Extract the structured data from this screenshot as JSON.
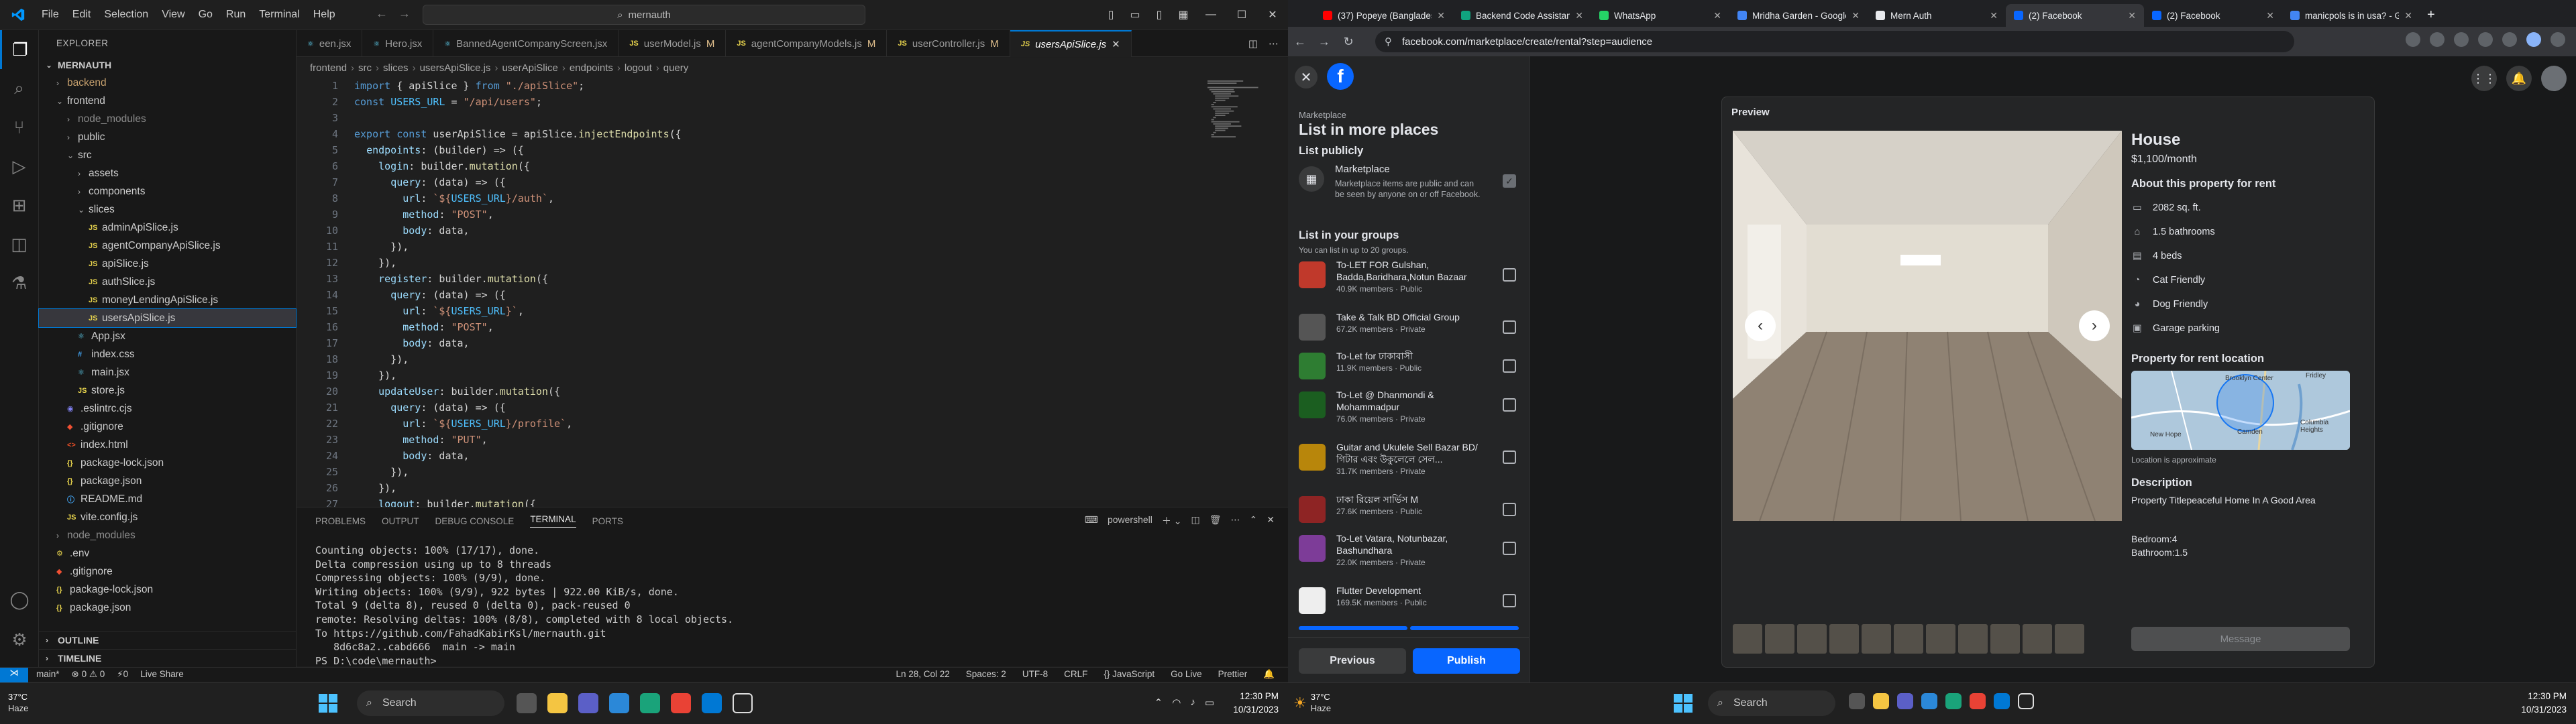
{
  "vscode": {
    "menu": [
      "File",
      "Edit",
      "Selection",
      "View",
      "Go",
      "Run",
      "Terminal",
      "Help"
    ],
    "search_box": "mernauth",
    "explorer_title": "EXPLORER",
    "root": "MERNAUTH",
    "tree": [
      {
        "label": "backend",
        "kind": "folder",
        "depth": 1,
        "open": false,
        "color": "#c6a06d"
      },
      {
        "label": "frontend",
        "kind": "folder",
        "depth": 1,
        "open": true,
        "color": "#cccccc"
      },
      {
        "label": "node_modules",
        "kind": "folder",
        "depth": 2,
        "open": false,
        "color": "#8b8b8b"
      },
      {
        "label": "public",
        "kind": "folder",
        "depth": 2,
        "open": false,
        "color": "#cccccc"
      },
      {
        "label": "src",
        "kind": "folder",
        "depth": 2,
        "open": true,
        "color": "#cccccc"
      },
      {
        "label": "assets",
        "kind": "folder",
        "depth": 3,
        "open": false,
        "color": "#cccccc"
      },
      {
        "label": "components",
        "kind": "folder",
        "depth": 3,
        "open": false,
        "color": "#cccccc"
      },
      {
        "label": "slices",
        "kind": "folder",
        "depth": 3,
        "open": true,
        "color": "#cccccc"
      },
      {
        "label": "adminApiSlice.js",
        "kind": "js",
        "depth": 4,
        "color": "#cccccc"
      },
      {
        "label": "agentCompanyApiSlice.js",
        "kind": "js",
        "depth": 4,
        "color": "#cccccc"
      },
      {
        "label": "apiSlice.js",
        "kind": "js",
        "depth": 4,
        "color": "#cccccc"
      },
      {
        "label": "authSlice.js",
        "kind": "js",
        "depth": 4,
        "color": "#cccccc"
      },
      {
        "label": "moneyLendingApiSlice.js",
        "kind": "js",
        "depth": 4,
        "color": "#cccccc"
      },
      {
        "label": "usersApiSlice.js",
        "kind": "js",
        "depth": 4,
        "color": "#cccccc",
        "selected": true
      },
      {
        "label": "App.jsx",
        "kind": "jsx",
        "depth": 3,
        "color": "#cccccc"
      },
      {
        "label": "index.css",
        "kind": "css",
        "depth": 3,
        "color": "#cccccc"
      },
      {
        "label": "main.jsx",
        "kind": "jsx",
        "depth": 3,
        "color": "#cccccc"
      },
      {
        "label": "store.js",
        "kind": "js",
        "depth": 3,
        "color": "#cccccc"
      },
      {
        "label": ".eslintrc.cjs",
        "kind": "eslint",
        "depth": 2,
        "color": "#cccccc"
      },
      {
        "label": ".gitignore",
        "kind": "git",
        "depth": 2,
        "color": "#cccccc"
      },
      {
        "label": "index.html",
        "kind": "html",
        "depth": 2,
        "color": "#cccccc"
      },
      {
        "label": "package-lock.json",
        "kind": "json",
        "depth": 2,
        "color": "#cccccc"
      },
      {
        "label": "package.json",
        "kind": "json",
        "depth": 2,
        "color": "#cccccc"
      },
      {
        "label": "README.md",
        "kind": "md",
        "depth": 2,
        "color": "#cccccc"
      },
      {
        "label": "vite.config.js",
        "kind": "js",
        "depth": 2,
        "color": "#cccccc"
      },
      {
        "label": "node_modules",
        "kind": "folder",
        "depth": 1,
        "open": false,
        "color": "#8b8b8b"
      },
      {
        "label": ".env",
        "kind": "env",
        "depth": 1,
        "color": "#cccccc"
      },
      {
        "label": ".gitignore",
        "kind": "git",
        "depth": 1,
        "color": "#cccccc"
      },
      {
        "label": "package-lock.json",
        "kind": "json",
        "depth": 1,
        "color": "#cccccc"
      },
      {
        "label": "package.json",
        "kind": "json",
        "depth": 1,
        "color": "#cccccc"
      }
    ],
    "outline_label": "OUTLINE",
    "timeline_label": "TIMELINE",
    "tabs": [
      {
        "label": "een.jsx",
        "mod": "",
        "active": false,
        "color": "#61dafb"
      },
      {
        "label": "Hero.jsx",
        "mod": "",
        "active": false,
        "color": "#61dafb"
      },
      {
        "label": "BannedAgentCompanyScreen.jsx",
        "mod": "",
        "active": false,
        "color": "#61dafb"
      },
      {
        "label": "userModel.js",
        "mod": "M",
        "active": false,
        "color": "#e8d44d"
      },
      {
        "label": "agentCompanyModels.js",
        "mod": "M",
        "active": false,
        "color": "#e8d44d"
      },
      {
        "label": "userController.js",
        "mod": "M",
        "active": false,
        "color": "#e8d44d"
      },
      {
        "label": "usersApiSlice.js",
        "mod": "",
        "active": true,
        "color": "#e8d44d"
      }
    ],
    "breadcrumb": [
      "frontend",
      "src",
      "slices",
      "usersApiSlice.js",
      "userApiSlice",
      "endpoints",
      "logout",
      "query"
    ],
    "code": [
      "import { apiSlice } from \"./apiSlice\";",
      "const USERS_URL = \"/api/users\";",
      "",
      "export const userApiSlice = apiSlice.injectEndpoints({",
      "  endpoints: (builder) => ({",
      "    login: builder.mutation({",
      "      query: (data) => ({",
      "        url: `${USERS_URL}/auth`,",
      "        method: \"POST\",",
      "        body: data,",
      "      }),",
      "    }),",
      "    register: builder.mutation({",
      "      query: (data) => ({",
      "        url: `${USERS_URL}`,",
      "        method: \"POST\",",
      "        body: data,",
      "      }),",
      "    }),",
      "    updateUser: builder.mutation({",
      "      query: (data) => ({",
      "        url: `${USERS_URL}/profile`,",
      "        method: \"PUT\",",
      "        body: data,",
      "      }),",
      "    }),",
      "    logout: builder.mutation({"
    ],
    "panel_tabs": [
      "PROBLEMS",
      "OUTPUT",
      "DEBUG CONSOLE",
      "TERMINAL",
      "PORTS"
    ],
    "shell": "powershell",
    "terminal": [
      "Counting objects: 100% (17/17), done.",
      "Delta compression using up to 8 threads",
      "Compressing objects: 100% (9/9), done.",
      "Writing objects: 100% (9/9), 922 bytes | 922.00 KiB/s, done.",
      "Total 9 (delta 8), reused 0 (delta 0), pack-reused 0",
      "remote: Resolving deltas: 100% (8/8), completed with 8 local objects.",
      "To https://github.com/FahadKabirKsl/mernauth.git",
      "   8d6c8a2..cabd666  main -> main",
      "PS D:\\code\\mernauth> "
    ],
    "status_left": [
      "main*",
      "⊗ 0 ⚠ 0",
      "⚡0",
      "Live Share"
    ],
    "status_right": [
      "Ln 28, Col 22",
      "Spaces: 2",
      "UTF-8",
      "CRLF",
      "{} JavaScript",
      "Go Live",
      "Prettier"
    ]
  },
  "taskbar_left": {
    "temp": "37°C",
    "cond": "Haze",
    "search": "Search",
    "time": "12:30 PM",
    "date": "10/31/2023"
  },
  "taskbar_right": {
    "temp": "37°C",
    "cond": "Haze",
    "search": "Search",
    "time": "12:30 PM",
    "date": "10/31/2023"
  },
  "chrome": {
    "tabs": [
      {
        "label": "(37) Popeye (Bangladesh)",
        "fav": "#ff0000",
        "active": false
      },
      {
        "label": "Backend Code Assistance",
        "fav": "#10a37f",
        "active": false
      },
      {
        "label": "WhatsApp",
        "fav": "#25d366",
        "active": false
      },
      {
        "label": "Mridha Garden - Google",
        "fav": "#4285f4",
        "active": false
      },
      {
        "label": "Mern Auth",
        "fav": "#e8eaed",
        "active": false
      },
      {
        "label": "(2) Facebook",
        "fav": "#0866ff",
        "active": true
      },
      {
        "label": "(2) Facebook",
        "fav": "#0866ff",
        "active": false
      },
      {
        "label": "manicpols is in usa? - G",
        "fav": "#4285f4",
        "active": false
      }
    ],
    "url": "facebook.com/marketplace/create/rental?step=audience"
  },
  "fb": {
    "crumb": "Marketplace",
    "title": "List in more places",
    "list_publicly": "List publicly",
    "marketplace_title": "Marketplace",
    "marketplace_desc": "Marketplace items are public and can be seen by anyone on or off Facebook.",
    "groups_heading": "List in your groups",
    "groups_sub": "You can list in up to 20 groups.",
    "groups": [
      {
        "name": "To-LET FOR Gulshan, Badda,Baridhara,Notun Bazaar",
        "meta": "40.9K members · Public",
        "color": "#c0392b"
      },
      {
        "name": "Take & Talk BD Official Group",
        "meta": "67.2K members · Private",
        "color": "#555555"
      },
      {
        "name": "To-Let for ঢাকাবাসী",
        "meta": "11.9K members · Public",
        "color": "#2e7d32"
      },
      {
        "name": "To-Let @ Dhanmondi & Mohammadpur",
        "meta": "76.0K members · Private",
        "color": "#1b5e20"
      },
      {
        "name": "Guitar and Ukulele Sell Bazar BD/গিটার এবং উকুলেলে সেল...",
        "meta": "31.7K members · Private",
        "color": "#b8860b"
      },
      {
        "name": "ঢাকা রিয়েল সার্ভিস M",
        "meta": "27.6K members · Public",
        "color": "#8e2424"
      },
      {
        "name": "To-Let Vatara, Notunbazar, Bashundhara",
        "meta": "22.0K members · Private",
        "color": "#7d3c98"
      },
      {
        "name": "Flutter Development",
        "meta": "169.5K members · Public",
        "color": "#eeeeee"
      }
    ],
    "prev_label": "Previous",
    "publish_label": "Publish",
    "preview_label": "Preview",
    "listing": {
      "title": "House",
      "price": "$1,100/month",
      "about_heading": "About this property for rent",
      "features": [
        {
          "icon": "▭",
          "text": "2082 sq. ft."
        },
        {
          "icon": "⌂",
          "text": "1.5 bathrooms"
        },
        {
          "icon": "▤",
          "text": "4 beds"
        },
        {
          "icon": "◔",
          "text": "Cat Friendly"
        },
        {
          "icon": "◕",
          "text": "Dog Friendly"
        },
        {
          "icon": "▣",
          "text": "Garage parking"
        }
      ],
      "location_heading": "Property for rent location",
      "map_labels": [
        "Brooklyn Center",
        "Fridley",
        "New Hope",
        "Camden",
        "Columbia Heights"
      ],
      "location_note": "Location is approximate",
      "desc_heading": "Description",
      "desc": "Property Titlepeaceful Home In A Good Area",
      "bedrooms": "Bedroom:4",
      "bathrooms": "Bathroom:1.5",
      "message": "Message"
    }
  }
}
